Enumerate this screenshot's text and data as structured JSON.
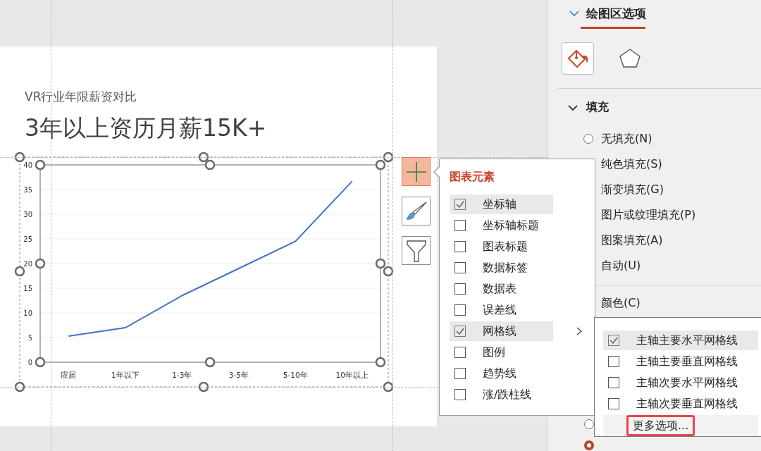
{
  "slide": {
    "subtitle": "VR行业年限薪资对比",
    "title": "3年以上资历月薪15K+",
    "chart": {
      "chart_data": {
        "type": "line",
        "categories": [
          "应届",
          "1年以下",
          "1-3年",
          "3-5年",
          "5-10年",
          "10年以上"
        ],
        "series": [
          {
            "color": "#4472c4",
            "values": [
              5.3,
              7,
              13.5,
              19,
              24.5,
              36.7
            ]
          }
        ],
        "ylim": [
          0,
          40
        ],
        "grid": true,
        "yticks": [
          0,
          5,
          10,
          15,
          20,
          25,
          30,
          35,
          40
        ]
      }
    }
  },
  "chart_tools": [
    {
      "kind": "elements",
      "selected": true
    },
    {
      "kind": "styles",
      "selected": false
    },
    {
      "kind": "filter",
      "selected": false
    }
  ],
  "elements_menu": {
    "title": "图表元素",
    "items": [
      {
        "label": "坐标轴",
        "checked": true,
        "submenu": false,
        "selected": true
      },
      {
        "label": "坐标轴标题",
        "checked": false,
        "submenu": false,
        "selected": false
      },
      {
        "label": "图表标题",
        "checked": false,
        "submenu": false,
        "selected": false
      },
      {
        "label": "数据标签",
        "checked": false,
        "submenu": false,
        "selected": false
      },
      {
        "label": "数据表",
        "checked": false,
        "submenu": false,
        "selected": false
      },
      {
        "label": "误差线",
        "checked": false,
        "submenu": false,
        "selected": false
      },
      {
        "label": "网格线",
        "checked": true,
        "submenu": true,
        "selected": true
      },
      {
        "label": "图例",
        "checked": false,
        "submenu": false,
        "selected": false
      },
      {
        "label": "趋势线",
        "checked": false,
        "submenu": false,
        "selected": false
      },
      {
        "label": "涨/跌柱线",
        "checked": false,
        "submenu": false,
        "selected": false
      }
    ]
  },
  "gridlines_submenu": {
    "items": [
      {
        "label": "主轴主要水平网格线",
        "checked": true,
        "selected": true
      },
      {
        "label": "主轴主要垂直网格线",
        "checked": false,
        "selected": false
      },
      {
        "label": "主轴次要水平网格线",
        "checked": false,
        "selected": false
      },
      {
        "label": "主轴次要垂直网格线",
        "checked": false,
        "selected": false
      }
    ],
    "more": "更多选项..."
  },
  "format_pane": {
    "title": "绘图区选项",
    "icon_tabs": [
      {
        "kind": "fill",
        "selected": true
      },
      {
        "kind": "shape",
        "selected": false
      }
    ],
    "section": {
      "title": "填充",
      "expanded": true
    },
    "fill_options": [
      {
        "label": "无填充(N)",
        "selected": false
      },
      {
        "label": "纯色填充(S)"
      },
      {
        "label": "渐变填充(G)"
      },
      {
        "label": "图片或纹理填充(P)"
      },
      {
        "label": "图案填充(A)"
      },
      {
        "label": "自动(U)"
      }
    ],
    "color_label": "颜色(C)",
    "line_options": [
      {
        "selected": false
      },
      {
        "selected": true
      }
    ]
  }
}
